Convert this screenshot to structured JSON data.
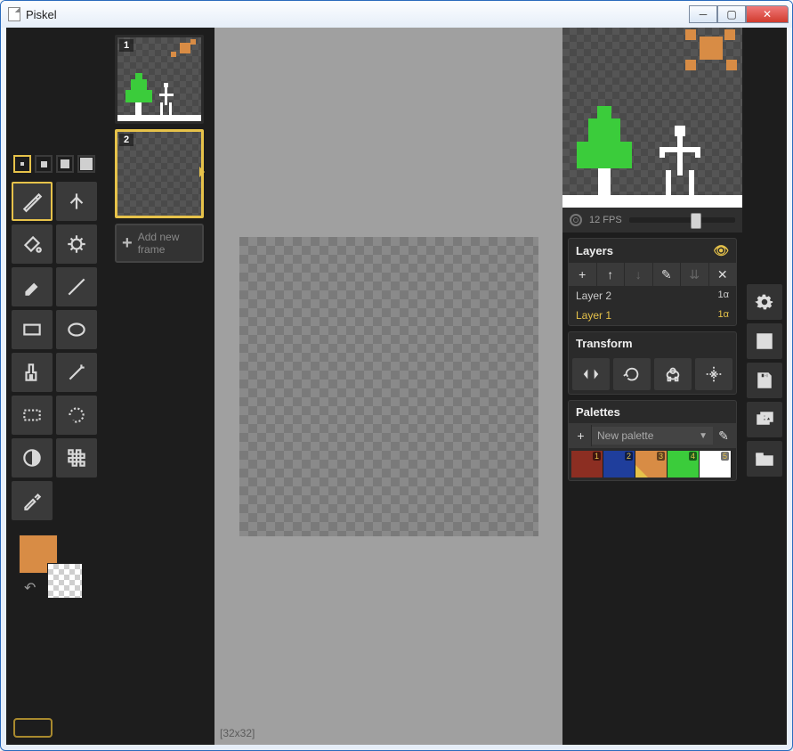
{
  "window": {
    "title": "Piskel"
  },
  "frames": {
    "list": [
      {
        "num": "1",
        "selected": false,
        "content": "scene"
      },
      {
        "num": "2",
        "selected": true,
        "content": "empty"
      }
    ],
    "add_label": "Add new frame"
  },
  "canvas": {
    "dims": "[32x32]"
  },
  "preview": {
    "fps_label": "12 FPS"
  },
  "layers": {
    "title": "Layers",
    "rows": [
      {
        "name": "Layer 2",
        "alpha": "1α",
        "selected": false
      },
      {
        "name": "Layer 1",
        "alpha": "1α",
        "selected": true
      }
    ]
  },
  "transform": {
    "title": "Transform"
  },
  "palettes": {
    "title": "Palettes",
    "selected_name": "New palette",
    "colors": [
      {
        "hex": "#8c2e22",
        "n": "1"
      },
      {
        "hex": "#1f3e9c",
        "n": "2"
      },
      {
        "hex": "#d88c45",
        "n": "3",
        "selected": true
      },
      {
        "hex": "#3bcc3b",
        "n": "4"
      },
      {
        "hex": "#ffffff",
        "n": "5"
      }
    ]
  }
}
